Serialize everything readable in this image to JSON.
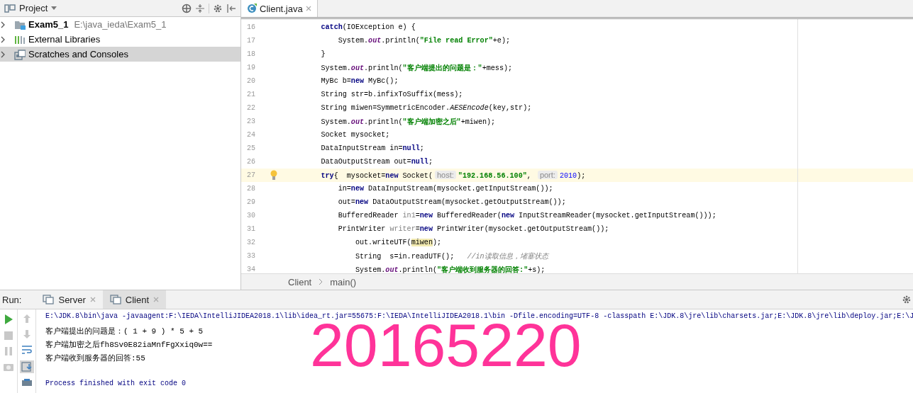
{
  "project_panel": {
    "title": "Project",
    "items": [
      {
        "name": "Exam5_1",
        "path": "E:\\java_ieda\\Exam5_1",
        "kind": "module",
        "selected": false
      },
      {
        "name": "External Libraries",
        "kind": "libraries",
        "selected": false
      },
      {
        "name": "Scratches and Consoles",
        "kind": "scratches",
        "selected": true
      }
    ]
  },
  "editor": {
    "tabs": [
      {
        "label": "Client.java",
        "selected": true
      }
    ],
    "lines": [
      {
        "number": "16",
        "current": false,
        "tokens": [
          {
            "kind": "keyword",
            "text": "        catch"
          },
          {
            "kind": "plain",
            "text": "(IOException e) {"
          }
        ]
      },
      {
        "number": "17",
        "current": false,
        "tokens": [
          {
            "kind": "plain",
            "text": "            System."
          },
          {
            "kind": "field",
            "text": "out"
          },
          {
            "kind": "plain",
            "text": ".println("
          },
          {
            "kind": "string",
            "text": "\"File read Error\""
          },
          {
            "kind": "plain",
            "text": "+e);"
          }
        ]
      },
      {
        "number": "18",
        "current": false,
        "tokens": [
          {
            "kind": "plain",
            "text": "        }"
          }
        ]
      },
      {
        "number": "19",
        "current": false,
        "tokens": [
          {
            "kind": "plain",
            "text": "        System."
          },
          {
            "kind": "field",
            "text": "out"
          },
          {
            "kind": "plain",
            "text": ".println("
          },
          {
            "kind": "string",
            "text": "\"客户端提出的问题是：\""
          },
          {
            "kind": "plain",
            "text": "+mess);"
          }
        ]
      },
      {
        "number": "20",
        "current": false,
        "tokens": [
          {
            "kind": "plain",
            "text": "        MyBc b="
          },
          {
            "kind": "keyword",
            "text": "new"
          },
          {
            "kind": "plain",
            "text": " MyBc();"
          }
        ]
      },
      {
        "number": "21",
        "current": false,
        "tokens": [
          {
            "kind": "plain",
            "text": "        String str=b.infixToSuffix(mess);"
          }
        ]
      },
      {
        "number": "22",
        "current": false,
        "tokens": [
          {
            "kind": "plain",
            "text": "        String miwen=SymmetricEncoder."
          },
          {
            "kind": "static",
            "text": "AESEncode"
          },
          {
            "kind": "plain",
            "text": "(key,str);"
          }
        ]
      },
      {
        "number": "23",
        "current": false,
        "tokens": [
          {
            "kind": "plain",
            "text": "        System."
          },
          {
            "kind": "field",
            "text": "out"
          },
          {
            "kind": "plain",
            "text": ".println("
          },
          {
            "kind": "string",
            "text": "\"客户端加密之后\""
          },
          {
            "kind": "plain",
            "text": "+miwen);"
          }
        ]
      },
      {
        "number": "24",
        "current": false,
        "tokens": [
          {
            "kind": "plain",
            "text": "        Socket mysocket;"
          }
        ]
      },
      {
        "number": "25",
        "current": false,
        "tokens": [
          {
            "kind": "plain",
            "text": "        DataInputStream in="
          },
          {
            "kind": "keyword",
            "text": "null"
          },
          {
            "kind": "plain",
            "text": ";"
          }
        ]
      },
      {
        "number": "26",
        "current": false,
        "tokens": [
          {
            "kind": "plain",
            "text": "        DataOutputStream out="
          },
          {
            "kind": "keyword",
            "text": "null"
          },
          {
            "kind": "plain",
            "text": ";"
          }
        ]
      },
      {
        "number": "27",
        "current": true,
        "tokens": [
          {
            "kind": "keyword",
            "text": "        try"
          },
          {
            "kind": "plain",
            "text": "{  mysocket="
          },
          {
            "kind": "keyword",
            "text": "new"
          },
          {
            "kind": "plain",
            "text": " Socket("
          },
          {
            "kind": "hint",
            "text": "host:"
          },
          {
            "kind": "string",
            "text": "\"192.168.56.100\""
          },
          {
            "kind": "plain",
            "text": ", "
          },
          {
            "kind": "hint",
            "text": "port:"
          },
          {
            "kind": "number",
            "text": "2010"
          },
          {
            "kind": "plain",
            "text": ");"
          }
        ]
      },
      {
        "number": "28",
        "current": false,
        "tokens": [
          {
            "kind": "plain",
            "text": "            in="
          },
          {
            "kind": "keyword",
            "text": "new"
          },
          {
            "kind": "plain",
            "text": " DataInputStream(mysocket.getInputStream());"
          }
        ]
      },
      {
        "number": "29",
        "current": false,
        "tokens": [
          {
            "kind": "plain",
            "text": "            out="
          },
          {
            "kind": "keyword",
            "text": "new"
          },
          {
            "kind": "plain",
            "text": " DataOutputStream(mysocket.getOutputStream());"
          }
        ]
      },
      {
        "number": "30",
        "current": false,
        "tokens": [
          {
            "kind": "plain",
            "text": "            BufferedReader "
          },
          {
            "kind": "unused",
            "text": "in1"
          },
          {
            "kind": "plain",
            "text": "="
          },
          {
            "kind": "keyword",
            "text": "new"
          },
          {
            "kind": "plain",
            "text": " BufferedReader("
          },
          {
            "kind": "keyword",
            "text": "new"
          },
          {
            "kind": "plain",
            "text": " InputStreamReader(mysocket.getInputStream()));"
          }
        ]
      },
      {
        "number": "31",
        "current": false,
        "tokens": [
          {
            "kind": "plain",
            "text": "            PrintWriter "
          },
          {
            "kind": "unused",
            "text": "writer"
          },
          {
            "kind": "plain",
            "text": "="
          },
          {
            "kind": "keyword",
            "text": "new"
          },
          {
            "kind": "plain",
            "text": " PrintWriter(mysocket.getOutputStream());"
          }
        ]
      },
      {
        "number": "32",
        "current": false,
        "tokens": [
          {
            "kind": "plain",
            "text": "                out.writeUTF("
          },
          {
            "kind": "highlight",
            "text": "miwen"
          },
          {
            "kind": "plain",
            "text": ");"
          }
        ]
      },
      {
        "number": "33",
        "current": false,
        "tokens": [
          {
            "kind": "plain",
            "text": "                String  s=in.readUTF();   "
          },
          {
            "kind": "comment",
            "text": "//in读取信息，堵塞状态"
          }
        ]
      },
      {
        "number": "34",
        "current": false,
        "tokens": [
          {
            "kind": "plain",
            "text": "                System."
          },
          {
            "kind": "field",
            "text": "out"
          },
          {
            "kind": "plain",
            "text": ".println("
          },
          {
            "kind": "string",
            "text": "\"客户端收到服务器的回答:\""
          },
          {
            "kind": "plain",
            "text": "+s);"
          }
        ]
      }
    ],
    "breadcrumbs": [
      "Client",
      "main()"
    ]
  },
  "run_panel": {
    "label": "Run:",
    "tabs": [
      {
        "label": "Server",
        "selected": false
      },
      {
        "label": "Client",
        "selected": true
      }
    ],
    "console": [
      {
        "kind": "command",
        "text": "E:\\JDK.8\\bin\\java -javaagent:F:\\IEDA\\IntelliJIDEA2018.1\\lib\\idea_rt.jar=55675:F:\\IEDA\\IntelliJIDEA2018.1\\bin -Dfile.encoding=UTF-8 -classpath E:\\JDK.8\\jre\\lib\\charsets.jar;E:\\JDK.8\\jre\\lib\\deploy.jar;E:\\J"
      },
      {
        "kind": "output",
        "text": "客户端提出的问题是：( 1 + 9 ) * 5 + 5"
      },
      {
        "kind": "output",
        "text": "客户端加密之后fh8Sv0E82iaMnfFgXxiq0w=="
      },
      {
        "kind": "output",
        "text": "客户端收到服务器的回答:55"
      },
      {
        "kind": "exit",
        "text": "Process finished with exit code 0"
      }
    ]
  },
  "overlay_text": "20165220"
}
